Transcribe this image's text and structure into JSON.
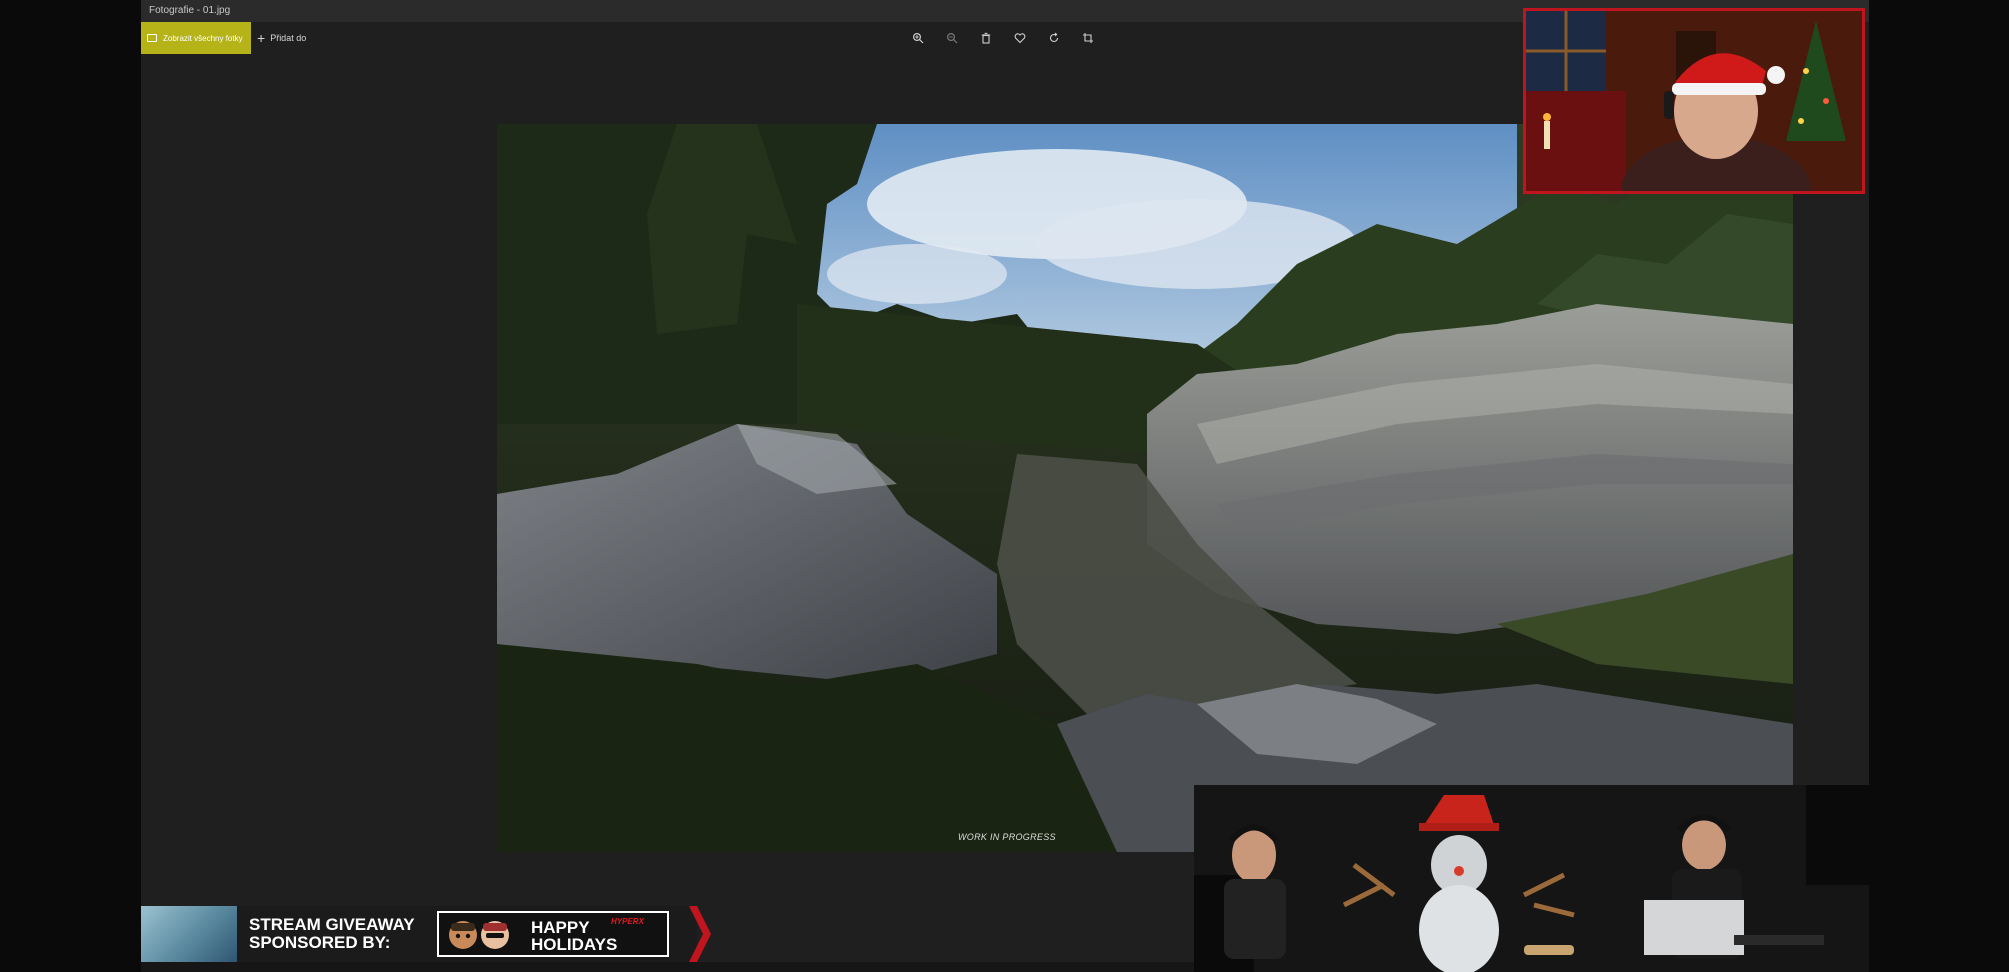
{
  "window": {
    "title": "Fotografie - 01.jpg"
  },
  "commandbar": {
    "primary_label": "Zobrazit všechny fotky",
    "add_label": "Přidat do",
    "tools": [
      {
        "name": "zoom-in-icon"
      },
      {
        "name": "zoom-out-icon"
      },
      {
        "name": "delete-icon"
      },
      {
        "name": "favorite-heart-icon"
      },
      {
        "name": "rotate-icon"
      },
      {
        "name": "crop-icon"
      }
    ]
  },
  "photo": {
    "caption": "WORK IN PROGRESS"
  },
  "banner": {
    "line1": "STREAM GIVEAWAY",
    "line2": "SPONSORED BY:",
    "holidays_line1": "HAPPY",
    "holidays_line2": "HOLIDAYS",
    "brand": "HYPERX"
  },
  "colors": {
    "accent": "#b5b318",
    "stream_red": "#c0141f",
    "app_background": "#1f1f1f"
  }
}
